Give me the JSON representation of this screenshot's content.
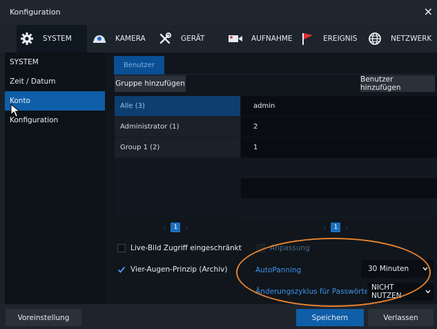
{
  "window": {
    "title": "Konfiguration",
    "close_glyph": "×"
  },
  "topnav": [
    {
      "label": "SYSTEM",
      "icon": "gear-icon",
      "active": true
    },
    {
      "label": "KAMERA",
      "icon": "camera-icon"
    },
    {
      "label": "GERÄT",
      "icon": "tools-icon"
    },
    {
      "label": "AUFNAHME",
      "icon": "recording-icon"
    },
    {
      "label": "EREIGNIS",
      "icon": "flag-icon"
    },
    {
      "label": "NETZWERK",
      "icon": "globe-icon"
    }
  ],
  "sidebar": {
    "items": [
      {
        "label": "SYSTEM"
      },
      {
        "label": "Zeit / Datum"
      },
      {
        "label": "Konto",
        "active": true
      },
      {
        "label": "Konfiguration"
      }
    ]
  },
  "content": {
    "tab": "Benutzer",
    "add_group_button": "Gruppe hinzufügen",
    "add_user_button": "Benutzer hinzufügen",
    "groups": [
      "Alle (3)",
      "Administrator (1)",
      "Group 1 (2)"
    ],
    "users": [
      "admin",
      "2",
      "1"
    ],
    "group_page": "1",
    "user_page": "1",
    "options": {
      "live_view_restricted": {
        "label": "Live-Bild Zugriff eingeschränkt",
        "checked": false
      },
      "four_eyes": {
        "label": "Vier-Augen-Prinzip (Archiv)",
        "checked": true
      },
      "customization": {
        "label": "Anpassung",
        "checked": false,
        "disabled": true
      },
      "autopanning": {
        "label": "AutoPanning",
        "value": "30 Minuten"
      },
      "password_cycle": {
        "label": "Änderungszyklus für Passwörter",
        "value": "NICHT NUTZEN"
      }
    }
  },
  "footer": {
    "default_button": "Voreinstellung",
    "save_button": "Speichern",
    "exit_button": "Verlassen"
  },
  "colors": {
    "accent": "#0f5ea8",
    "selection": "#0e3e70",
    "label_blue": "#3d92e8",
    "annotation": "#e8822e"
  }
}
